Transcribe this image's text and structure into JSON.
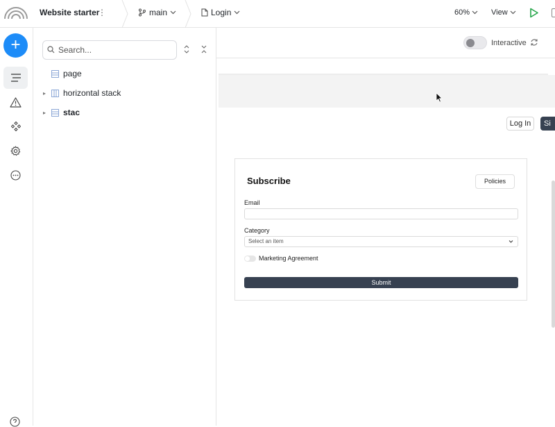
{
  "topbar": {
    "project_name": "Website starter",
    "kebab": "⋮",
    "branch": "main",
    "page": "Login",
    "zoom": "60%",
    "view": "View"
  },
  "rail": {
    "add": "+",
    "icons": [
      "layers-icon",
      "warning-icon",
      "components-icon",
      "settings-icon",
      "more-icon",
      "help-icon"
    ]
  },
  "layers": {
    "search_placeholder": "Search...",
    "items": [
      {
        "label": "page",
        "expandable": false
      },
      {
        "label": "horizontal stack",
        "expandable": true
      },
      {
        "label": "stac",
        "expandable": true
      }
    ]
  },
  "canvas": {
    "interactive_label": "Interactive",
    "interactive_on": false
  },
  "preview": {
    "login_label": "Log In",
    "signup_label": "Si",
    "card": {
      "title": "Subscribe",
      "policies_label": "Policies",
      "email_label": "Email",
      "email_value": "",
      "category_label": "Category",
      "category_placeholder": "Select an item",
      "marketing_label": "Marketing Agreement",
      "submit_label": "Submit"
    }
  },
  "colors": {
    "accent": "#1d8cf8",
    "dark_button": "#374151",
    "play": "#22a447"
  }
}
